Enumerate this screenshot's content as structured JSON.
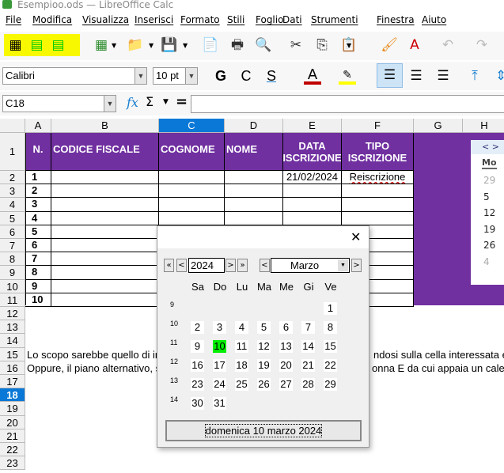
{
  "window": {
    "title": "Esempioo.ods — LibreOffice Calc"
  },
  "menu": [
    "File",
    "Modifica",
    "Visualizza",
    "Inserisci",
    "Formato",
    "Stili",
    "Foglio",
    "Dati",
    "Strumenti",
    "Finestra",
    "Aiuto"
  ],
  "toolbar": {
    "font_name": "Calibri",
    "font_size": "10 pt",
    "bold": "G",
    "italic": "C",
    "underline": "S",
    "font_color": "#c00000",
    "highlight_color": "#ffff00",
    "icons": [
      "calendar-icon",
      "insert-rows-icon",
      "insert-rows-icon",
      "new-spreadsheet-icon",
      "open-folder-icon",
      "save-icon",
      "export-pdf-icon",
      "print-icon",
      "print-preview-icon",
      "cut-icon",
      "copy-icon",
      "paste-icon",
      "clone-formatting-icon",
      "clear-formatting-icon",
      "undo-icon",
      "redo-icon"
    ]
  },
  "formula_bar": {
    "cell_ref": "C18",
    "fx": "fx",
    "sum": "Σ",
    "equals": "=",
    "value": ""
  },
  "columns": [
    "A",
    "B",
    "C",
    "D",
    "E",
    "F",
    "G",
    "H"
  ],
  "selected_column": "C",
  "selected_row": "18",
  "rows": [
    "1",
    "2",
    "3",
    "4",
    "5",
    "6",
    "7",
    "8",
    "9",
    "10",
    "11",
    "12",
    "13",
    "14",
    "15",
    "16",
    "17",
    "18",
    "19",
    "20",
    "21",
    "22",
    "23"
  ],
  "table": {
    "headers": [
      "N.",
      "CODICE FISCALE",
      "COGNOME",
      "NOME",
      "DATA ISCRIZIONE",
      "TIPO ISCRIZIONE"
    ],
    "header_color": "#7030a0",
    "numbers": [
      "1",
      "2",
      "3",
      "4",
      "5",
      "6",
      "7",
      "8",
      "9",
      "10"
    ],
    "row1_date": "21/02/2024",
    "row1_type": "Reiscrizione"
  },
  "notes": {
    "line15_left": "Lo scopo sarebbe quello di inse",
    "line15_right": "ndosi sulla cella interessata e cli",
    "line16_left": "Oppure, il piano alternativo, sar",
    "line16_right": "onna E da cui appaia un calendar"
  },
  "mini_calendar": {
    "nav": "< >",
    "day_header": "Mo",
    "days": [
      "29",
      "5",
      "12",
      "19",
      "26",
      "4"
    ]
  },
  "date_dialog": {
    "close": "✕",
    "year": "2024",
    "month": "Marzo",
    "nav_first": "«",
    "nav_prev": "<",
    "nav_next": ">",
    "nav_last": "»",
    "weekdays": [
      "Sa",
      "Do",
      "Lu",
      "Ma",
      "Me",
      "Gi",
      "Ve"
    ],
    "weeks": [
      {
        "num": "9",
        "days": [
          "",
          "",
          "",
          "",
          "",
          "",
          "1"
        ]
      },
      {
        "num": "10",
        "days": [
          "2",
          "3",
          "4",
          "5",
          "6",
          "7",
          "8"
        ]
      },
      {
        "num": "11",
        "days": [
          "9",
          "10",
          "11",
          "12",
          "13",
          "14",
          "15"
        ]
      },
      {
        "num": "12",
        "days": [
          "16",
          "17",
          "18",
          "19",
          "20",
          "21",
          "22"
        ]
      },
      {
        "num": "13",
        "days": [
          "23",
          "24",
          "25",
          "26",
          "27",
          "28",
          "29"
        ]
      },
      {
        "num": "14",
        "days": [
          "30",
          "31",
          "",
          "",
          "",
          "",
          ""
        ]
      }
    ],
    "selected_day": "10",
    "selected_color": "#00ee00",
    "selected_label": "domenica 10 marzo 2024"
  }
}
